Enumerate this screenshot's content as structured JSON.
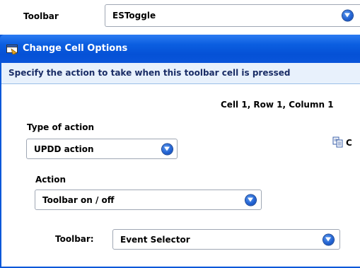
{
  "top_row": {
    "label": "Toolbar",
    "value": "ESToggle"
  },
  "dialog": {
    "title": "Change Cell Options",
    "subtitle": "Specify the action to take when this toolbar cell is pressed",
    "cell_info": "Cell 1, Row 1, Column 1",
    "type_of_action": {
      "label": "Type of action",
      "value": "UPDD action"
    },
    "copy_label": "C",
    "action": {
      "label": "Action",
      "value": "Toolbar on / off"
    },
    "toolbar_field": {
      "label": "Toolbar:",
      "value": "Event Selector"
    }
  },
  "icons": [
    "chevron-down-icon",
    "dialog-window-icon",
    "copy-icon"
  ],
  "colors": {
    "titlebar": "#0a55da",
    "hint_band": "#e8f1fc",
    "dropdown_button": "#1f5fd0"
  }
}
